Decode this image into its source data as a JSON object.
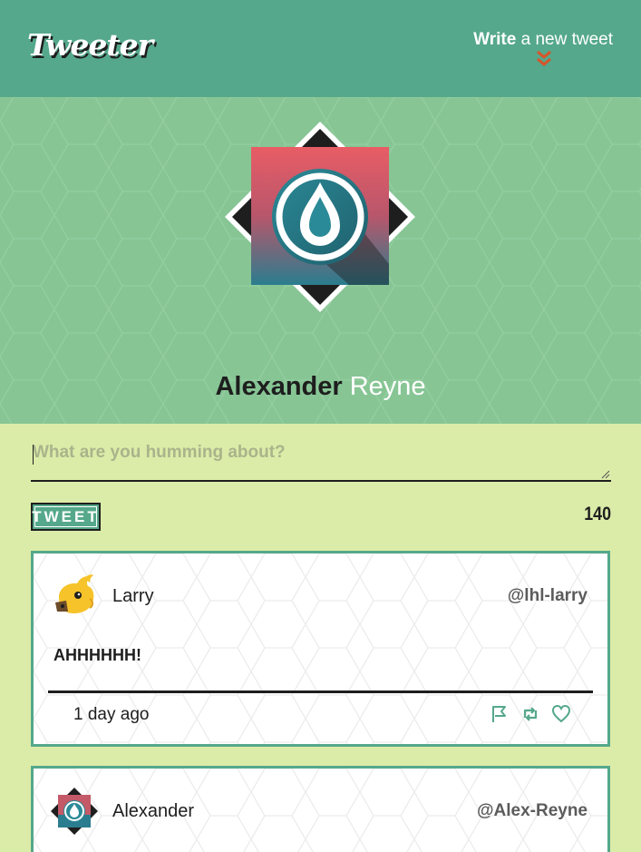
{
  "nav": {
    "logo": "Tweeter",
    "compose_bold": "Write",
    "compose_rest": " a new tweet",
    "compose_icon": "double-chevron-down-icon"
  },
  "profile": {
    "first_name": "Alexander",
    "last_name": "Reyne"
  },
  "compose": {
    "placeholder": "What are you humming about?",
    "button_label": "TWEET",
    "counter": "140"
  },
  "tweets": [
    {
      "name": "Larry",
      "handle": "@lhl-larry",
      "body": "AHHHHHH!",
      "time": "1 day ago",
      "actions": [
        "flag-icon",
        "retweet-icon",
        "heart-icon"
      ]
    },
    {
      "name": "Alexander",
      "handle": "@Alex-Reyne"
    }
  ],
  "colors": {
    "nav_bg": "#55a88b",
    "profile_bg": "#87c595",
    "page_bg": "#dbeca8",
    "accent": "#55a88b",
    "arrow": "#d9532b"
  }
}
